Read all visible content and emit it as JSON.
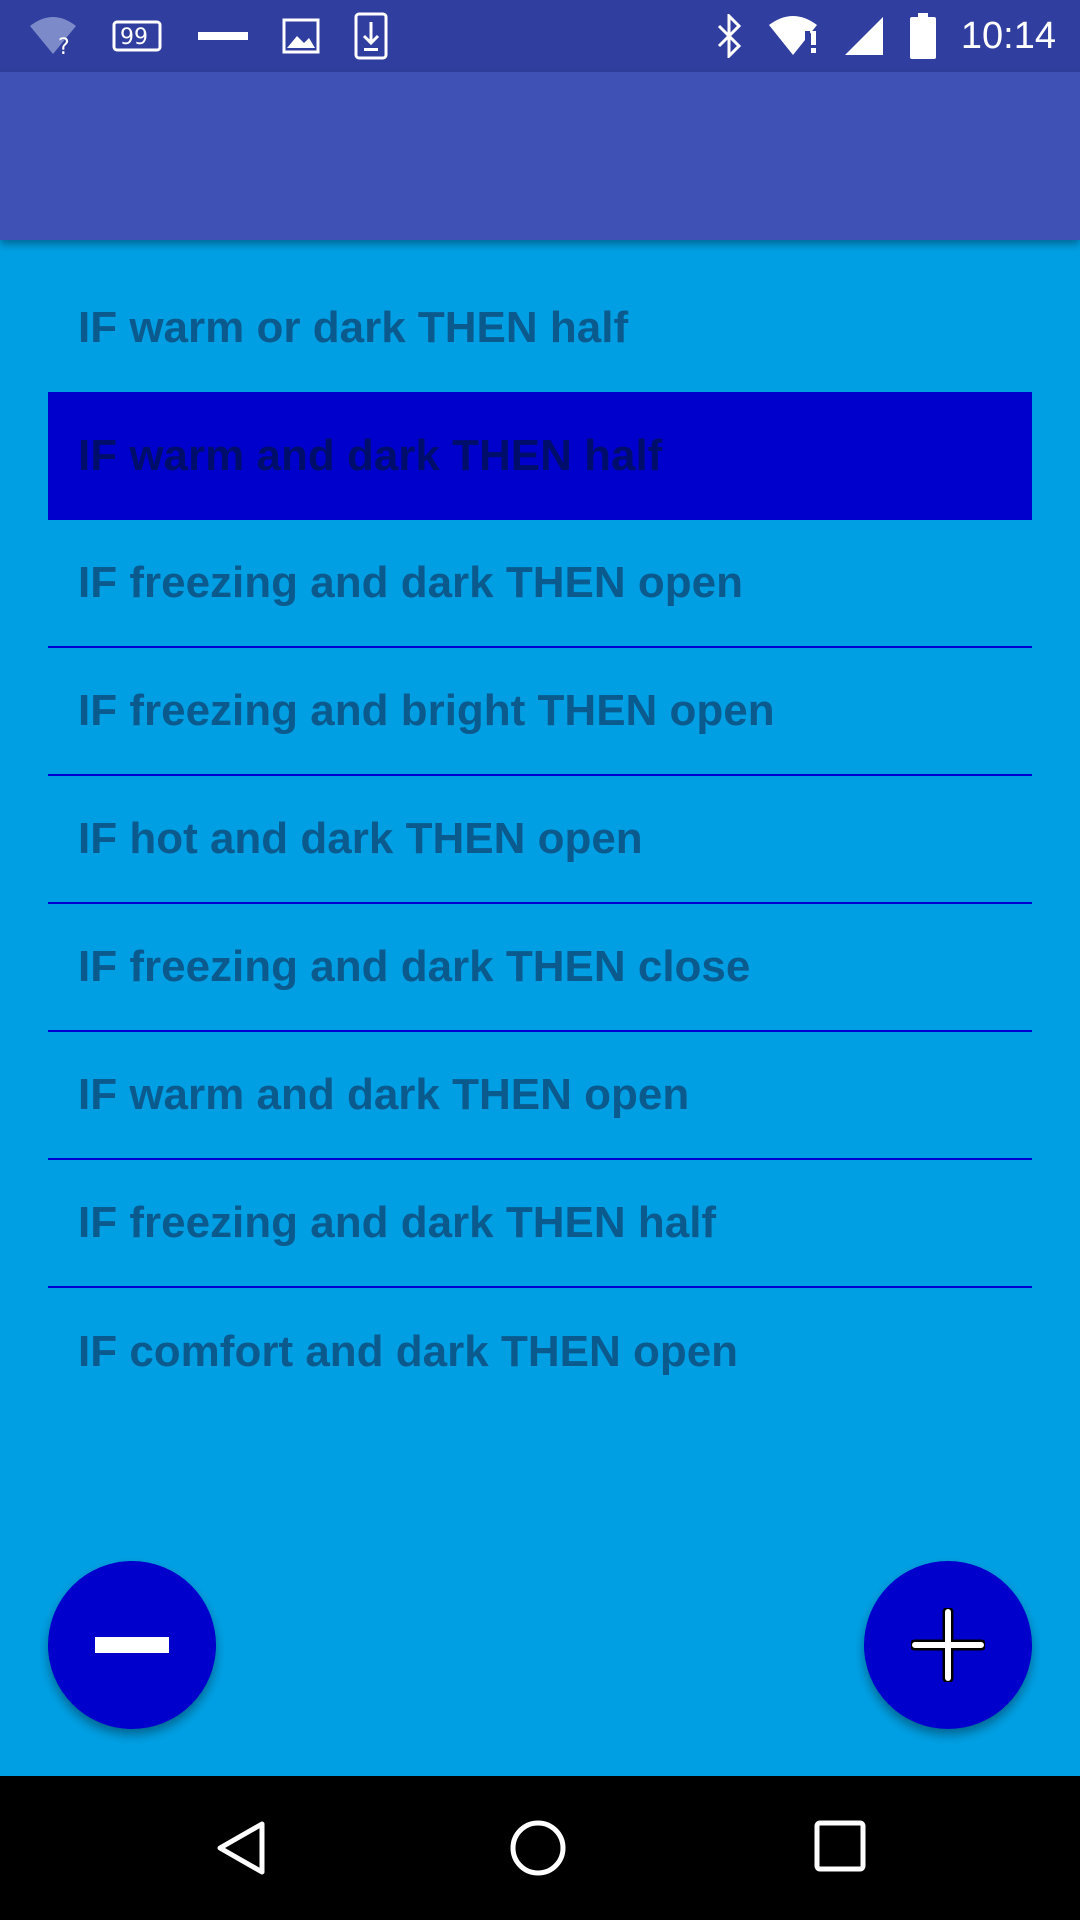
{
  "status_bar": {
    "time": "10:14",
    "left_icons": [
      "wifi-unknown-icon",
      "notification-count-icon",
      "minus-notification-icon",
      "image-icon",
      "download-icon"
    ],
    "notification_count": "99",
    "right_icons": [
      "bluetooth-icon",
      "wifi-alert-icon",
      "cell-signal-icon",
      "battery-icon"
    ]
  },
  "app_bar": {
    "color": "#3F51B5"
  },
  "rules": {
    "items": [
      {
        "label": "IF warm or dark THEN half",
        "selected": false
      },
      {
        "label": "IF warm and dark THEN half",
        "selected": true
      },
      {
        "label": "IF freezing and dark THEN open",
        "selected": false
      },
      {
        "label": "IF freezing and bright THEN open",
        "selected": false
      },
      {
        "label": "IF hot and dark THEN open",
        "selected": false
      },
      {
        "label": "IF freezing and dark THEN close",
        "selected": false
      },
      {
        "label": "IF warm and dark THEN open",
        "selected": false
      },
      {
        "label": "IF freezing and dark THEN half",
        "selected": false
      },
      {
        "label": "IF comfort and dark THEN open",
        "selected": false
      }
    ]
  },
  "fabs": {
    "remove_icon": "minus-icon",
    "add_icon": "plus-icon"
  },
  "colors": {
    "background": "#009FE3",
    "status_bar": "#303F9F",
    "accent": "#0000CC",
    "divider": "#0000D0",
    "rule_text": "#0B5A8E"
  },
  "nav_bar": {
    "icons": [
      "back-icon",
      "home-icon",
      "recents-icon"
    ]
  }
}
